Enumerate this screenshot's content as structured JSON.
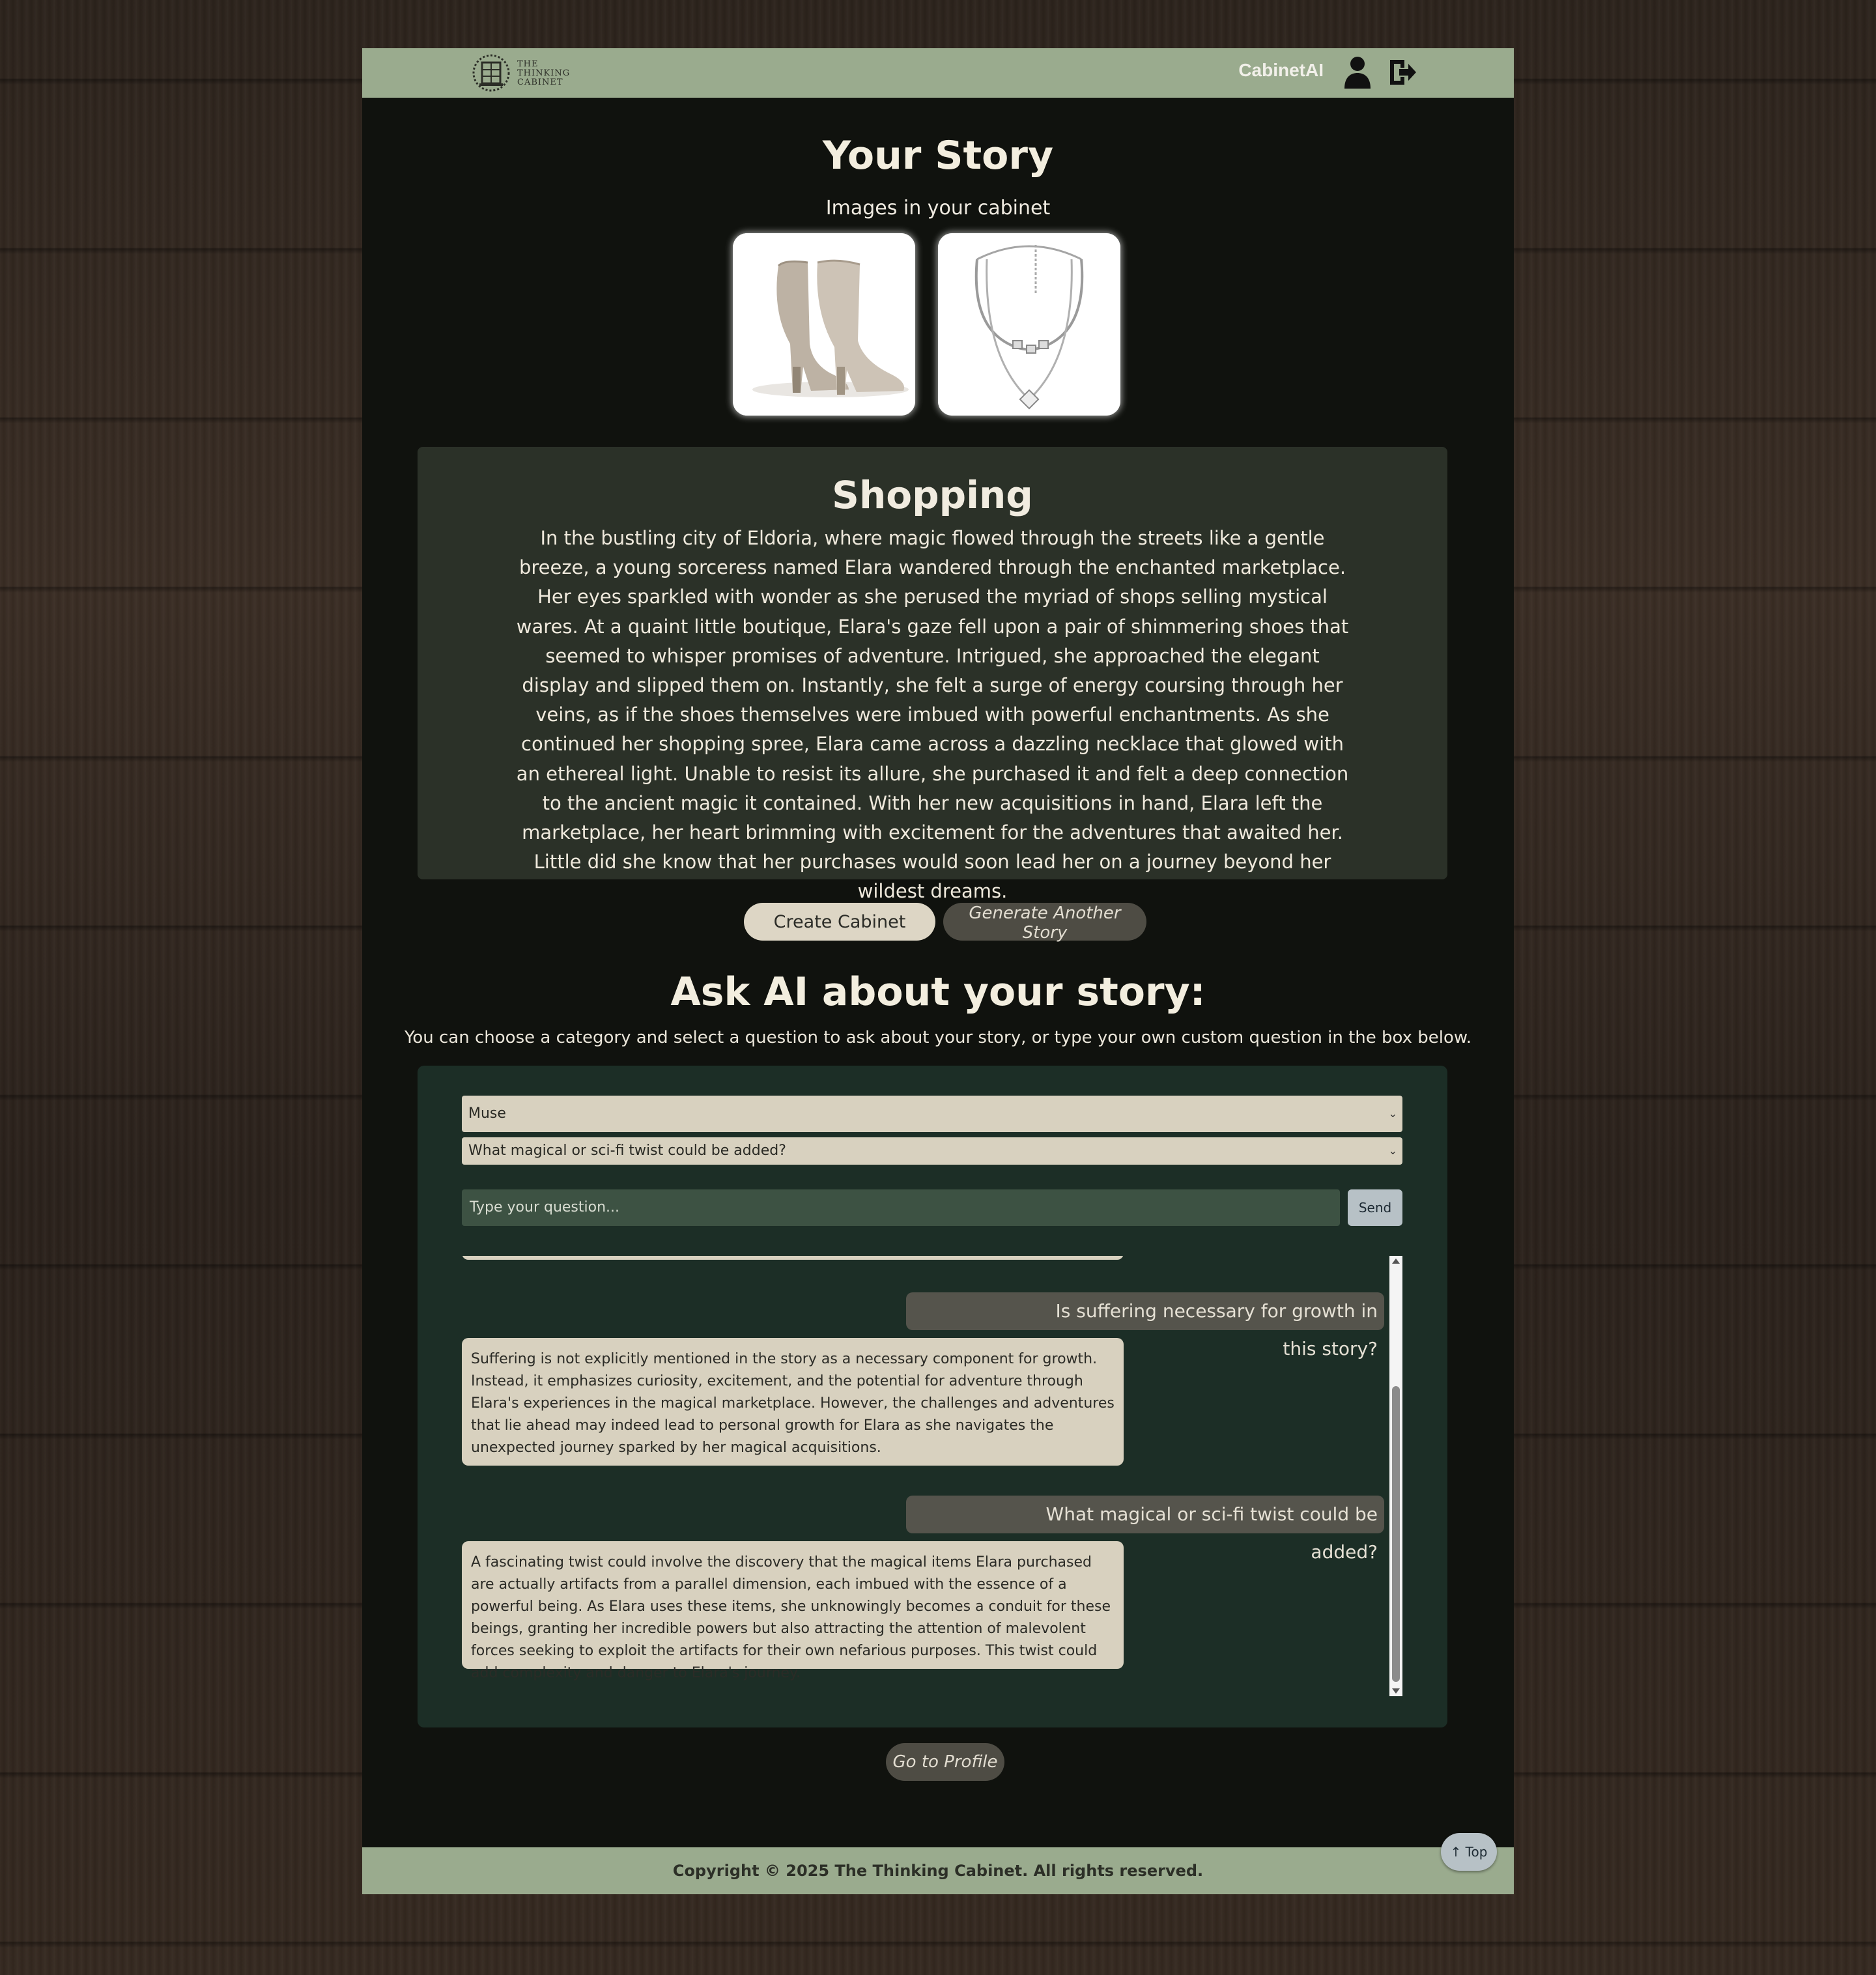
{
  "colors": {
    "navbar": "#9aab8e",
    "page_bg": "#10120e",
    "story_card": "#2b3128",
    "ai_card": "#1c2e26",
    "bubble_ai": "#d8d1bf",
    "bubble_user": "#55544c"
  },
  "navbar": {
    "logo_text": [
      "THE",
      "THINKING",
      "CABINET"
    ],
    "brand": "CabinetAI",
    "user_icon": "user-icon",
    "logout_icon": "logout-icon"
  },
  "story": {
    "page_title": "Your Story",
    "images_label": "Images in your cabinet",
    "images": [
      "ankle-boots-image",
      "necklace-image"
    ],
    "title": "Shopping",
    "body": "In the bustling city of Eldoria, where magic flowed through the streets like a gentle breeze, a young sorceress named Elara wandered through the enchanted marketplace. Her eyes sparkled with wonder as she perused the myriad of shops selling mystical wares. At a quaint little boutique, Elara's gaze fell upon a pair of shimmering shoes that seemed to whisper promises of adventure. Intrigued, she approached the elegant display and slipped them on. Instantly, she felt a surge of energy coursing through her veins, as if the shoes themselves were imbued with powerful enchantments. As she continued her shopping spree, Elara came across a dazzling necklace that glowed with an ethereal light. Unable to resist its allure, she purchased it and felt a deep connection to the ancient magic it contained. With her new acquisitions in hand, Elara left the marketplace, her heart brimming with excitement for the adventures that awaited her. Little did she know that her purchases would soon lead her on a journey beyond her wildest dreams."
  },
  "actions": {
    "create_cabinet": "Create Cabinet",
    "generate_another": "Generate Another Story",
    "go_to_profile": "Go to Profile"
  },
  "ask": {
    "heading": "Ask AI about your story:",
    "description": "You can choose a category and select a question to ask about your story, or type your own custom question in the box below.",
    "category_selected": "Muse",
    "question_selected": "What magical or sci-fi twist could be added?",
    "input_placeholder": "Type your question...",
    "send_label": "Send"
  },
  "chat": {
    "messages": [
      {
        "role": "user",
        "text": "Is suffering necessary for growth in this story?"
      },
      {
        "role": "ai",
        "text": "Suffering is not explicitly mentioned in the story as a necessary component for growth. Instead, it emphasizes curiosity, excitement, and the potential for adventure through Elara's experiences in the magical marketplace. However, the challenges and adventures that lie ahead may indeed lead to personal growth for Elara as she navigates the unexpected journey sparked by her magical acquisitions."
      },
      {
        "role": "user",
        "text": "What magical or sci-fi twist could be added?"
      },
      {
        "role": "ai",
        "text": "A fascinating twist could involve the discovery that the magical items Elara purchased are actually artifacts from a parallel dimension, each imbued with the essence of a powerful being. As Elara uses these items, she unknowingly becomes a conduit for these beings, granting her incredible powers but also attracting the attention of malevolent forces seeking to exploit the artifacts for their own nefarious purposes. This twist could add complexity and danger to Elara's journey."
      }
    ]
  },
  "footer": {
    "copyright": "Copyright © 2025 The Thinking Cabinet. All rights reserved.",
    "top_button": "↑ Top"
  }
}
